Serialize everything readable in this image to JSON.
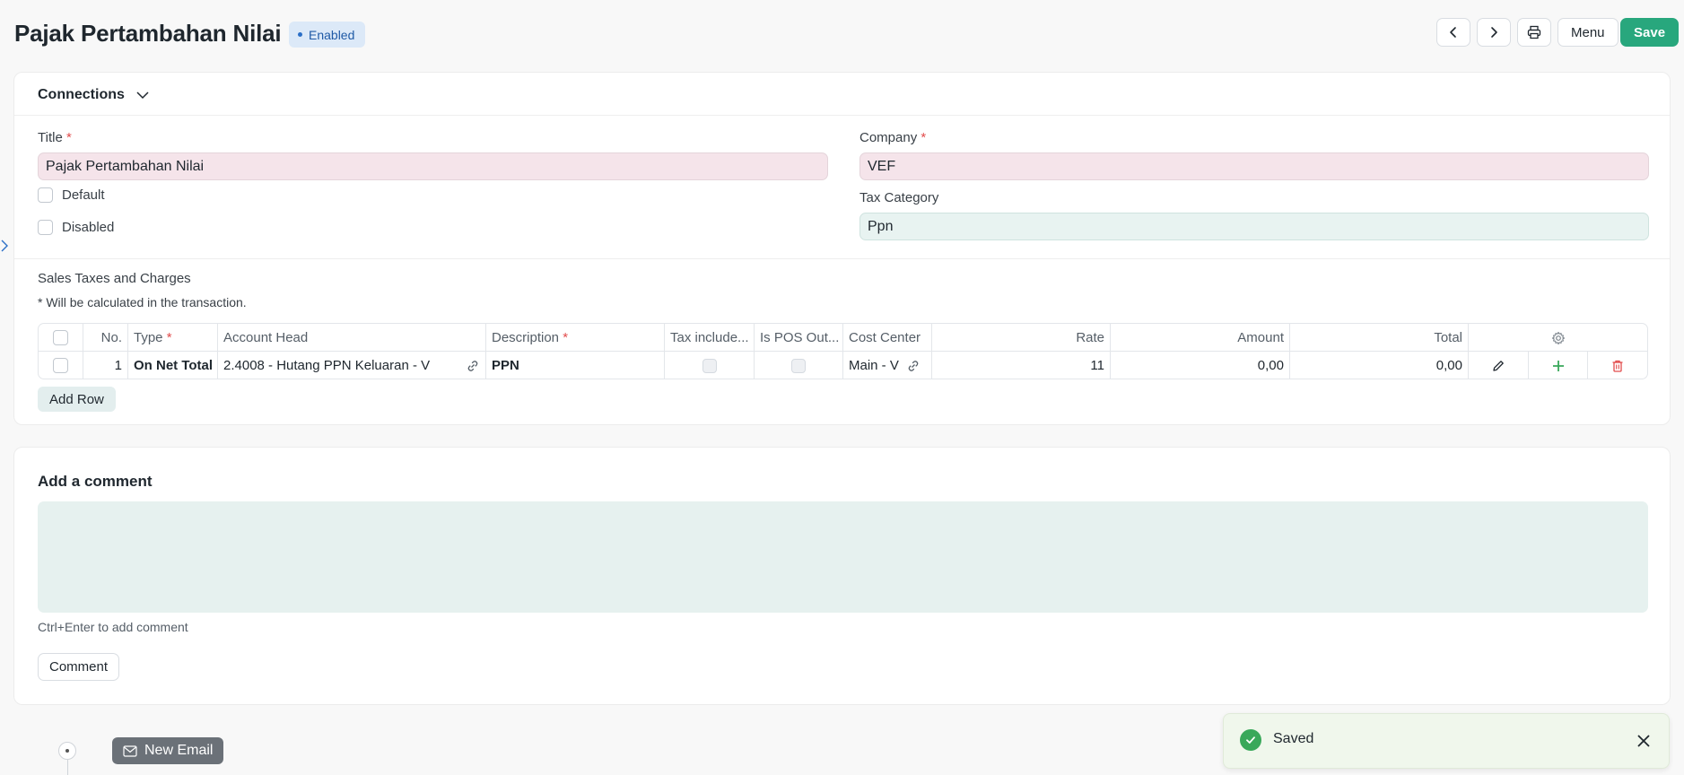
{
  "header": {
    "title": "Pajak Pertambahan Nilai",
    "status": "Enabled",
    "menu_label": "Menu",
    "save_label": "Save"
  },
  "connections": {
    "label": "Connections"
  },
  "form": {
    "title_label": "Title",
    "title_value": "Pajak Pertambahan Nilai",
    "company_label": "Company",
    "company_value": "VEF",
    "tax_category_label": "Tax Category",
    "tax_category_value": "Ppn",
    "default_label": "Default",
    "disabled_label": "Disabled",
    "required_marker": "*"
  },
  "taxes": {
    "section_label": "Sales Taxes and Charges",
    "note": "* Will be calculated in the transaction.",
    "columns": {
      "no": "No.",
      "type": "Type",
      "account_head": "Account Head",
      "description": "Description",
      "tax_included": "Tax include...",
      "is_pos": "Is POS Out...",
      "cost_center": "Cost Center",
      "rate": "Rate",
      "amount": "Amount",
      "total": "Total"
    },
    "rows": [
      {
        "no": "1",
        "type": "On Net Total",
        "account_head": "2.4008 - Hutang PPN Keluaran - V",
        "description": "PPN",
        "cost_center": "Main - V",
        "rate": "11",
        "amount": "0,00",
        "total": "0,00"
      }
    ],
    "add_row_label": "Add Row"
  },
  "comment": {
    "title": "Add a comment",
    "hint": "Ctrl+Enter to add comment",
    "button_label": "Comment"
  },
  "timeline": {
    "new_email_label": "New Email"
  },
  "toast": {
    "message": "Saved"
  },
  "colors": {
    "save": "#28a77d",
    "badge_bg": "#dce9f8",
    "badge_text": "#1f5aa6",
    "required": "#e24c4c",
    "add_icon": "#39a85a",
    "delete_icon": "#e24c4c"
  }
}
